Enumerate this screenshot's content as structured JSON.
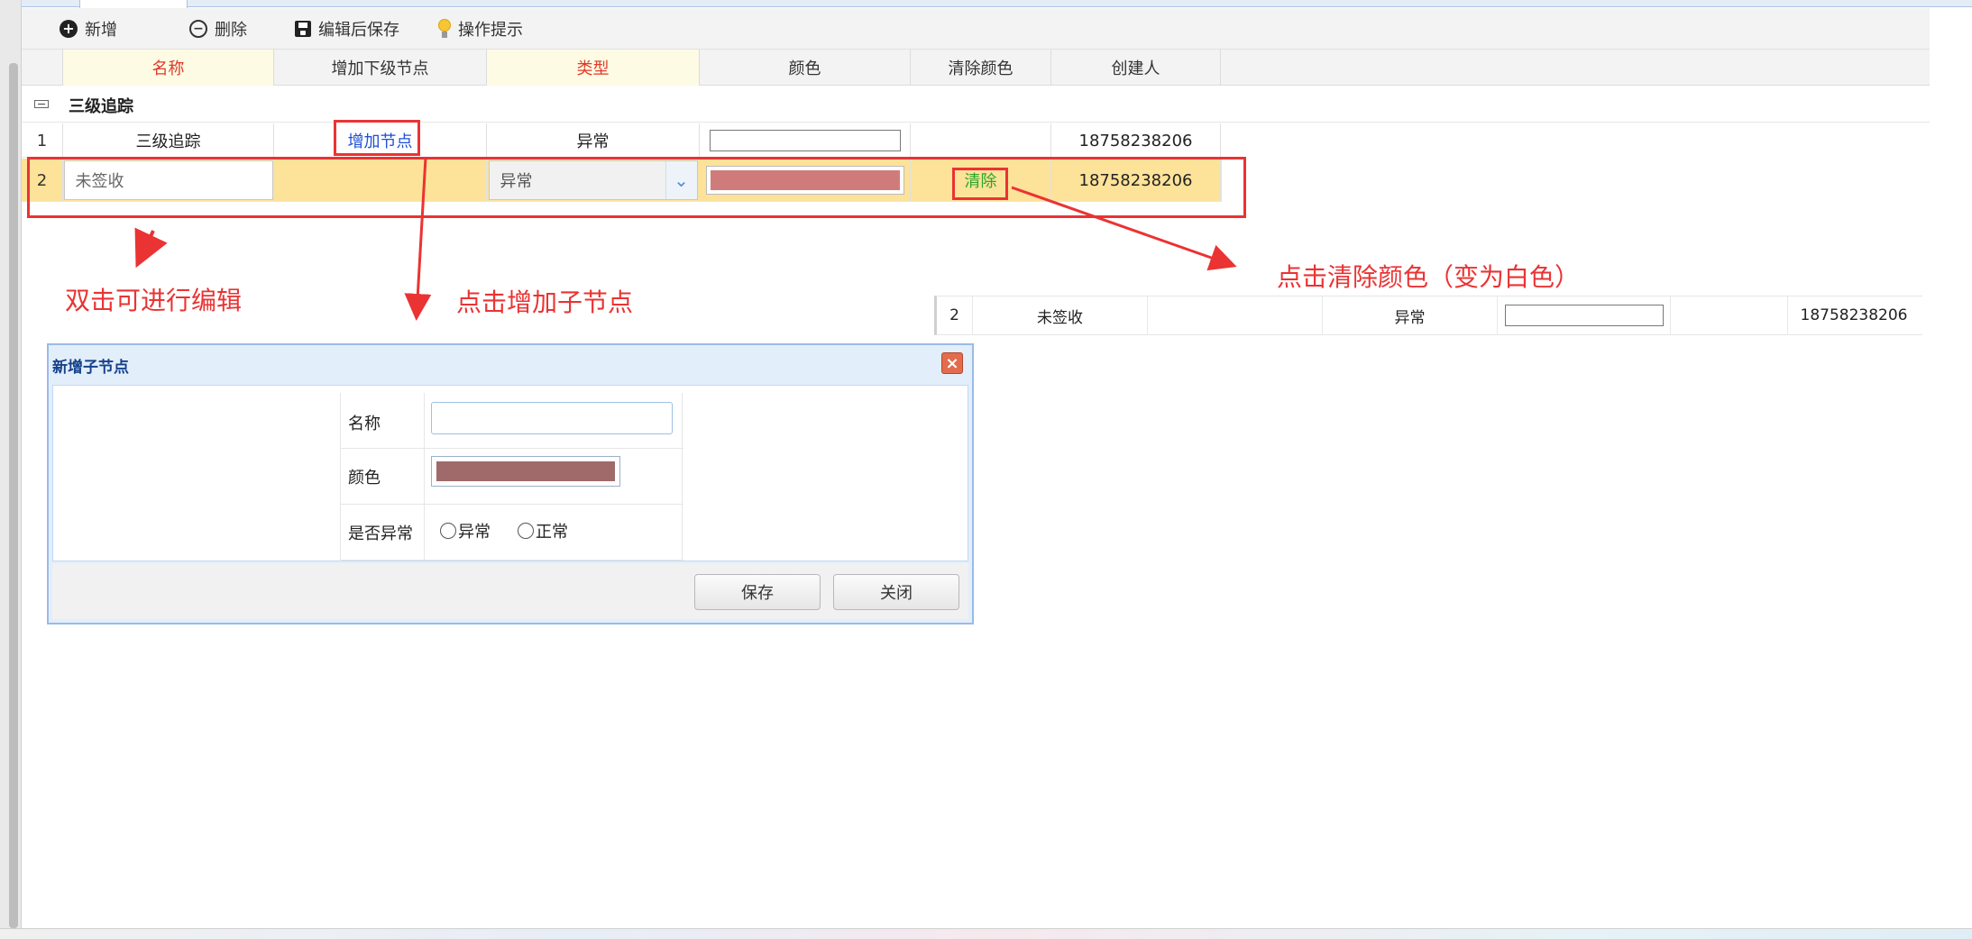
{
  "toolbar": {
    "add": "新增",
    "delete": "删除",
    "save": "编辑后保存",
    "tip": "操作提示"
  },
  "columns": [
    "名称",
    "增加下级节点",
    "类型",
    "颜色",
    "清除颜色",
    "创建人"
  ],
  "group": {
    "label": "三级追踪"
  },
  "rows": [
    {
      "num": "1",
      "name": "三级追踪",
      "add_child": "增加节点",
      "type": "异常",
      "color": "#ffffff",
      "clear": "",
      "creator": "18758238206"
    },
    {
      "num": "2",
      "name": "未签收",
      "add_child": "",
      "type": "异常",
      "color": "#d07b7b",
      "clear": "清除",
      "creator": "18758238206"
    }
  ],
  "annotations": {
    "edit": "双击可进行编辑",
    "add_child": "点击增加子节点",
    "clear_color": "点击清除颜色（变为白色）"
  },
  "preview_row": {
    "num": "2",
    "name": "未签收",
    "type": "异常",
    "color": "#ffffff",
    "creator": "18758238206"
  },
  "dialog": {
    "title": "新增子节点",
    "name_label": "名称",
    "name_value": "",
    "color_label": "颜色",
    "color_value": "#a06a6a",
    "abnormal_label": "是否异常",
    "option_abnormal": "异常",
    "option_normal": "正常",
    "save": "保存",
    "close": "关闭"
  }
}
